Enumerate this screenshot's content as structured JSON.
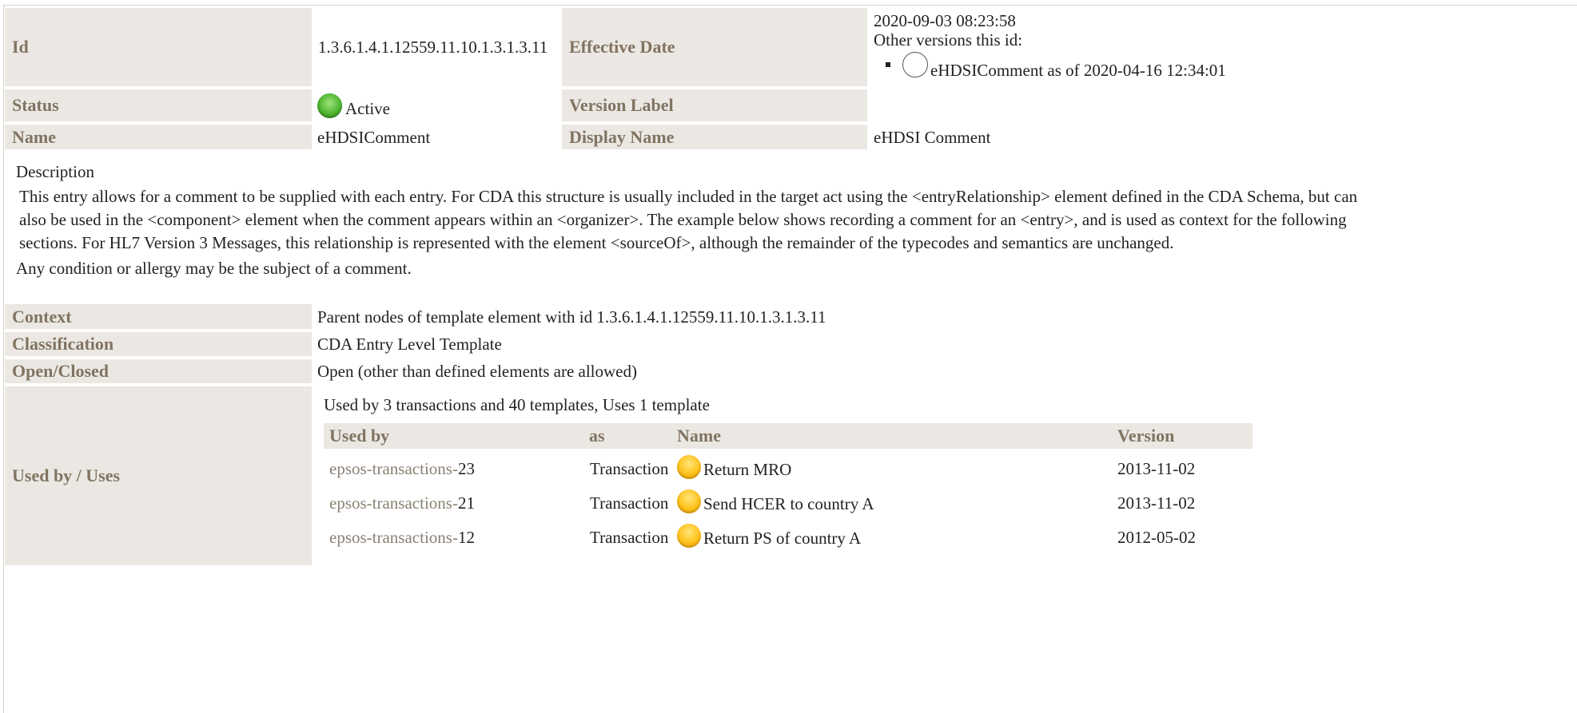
{
  "header": {
    "id_label": "Id",
    "id_value": "1.3.6.1.4.1.12559.11.10.1.3.1.3.11",
    "effective_date_label": "Effective Date",
    "effective_date_value": "2020-09-03 08:23:58",
    "other_versions_label": "Other versions this id:",
    "other_version_item": "eHDSIComment as of 2020-04-16 12:34:01",
    "status_label": "Status",
    "status_value": "Active",
    "status_color": "#4fb630",
    "version_label_label": "Version Label",
    "version_label_value": "",
    "name_label": "Name",
    "name_value": "eHDSIComment",
    "display_name_label": "Display Name",
    "display_name_value": "eHDSI Comment"
  },
  "description": {
    "heading": "Description",
    "line1": "This entry allows for a comment to be supplied with each entry. For CDA this structure is usually included in the target act using the <entryRelationship> element defined in the CDA Schema, but can",
    "line2": "also be used in the <component> element when the comment appears within an <organizer>. The example below shows recording a comment for an <entry>, and is used as context for the following",
    "line3": "sections. For HL7 Version 3 Messages, this relationship is represented with the element <sourceOf>, although the remainder of the typecodes and semantics are unchanged.",
    "paragraph2": "Any condition or allergy may be the subject of a comment."
  },
  "properties": {
    "context_label": "Context",
    "context_value": "Parent nodes of template element with id 1.3.6.1.4.1.12559.11.10.1.3.1.3.11",
    "classification_label": "Classification",
    "classification_value": "CDA Entry Level Template",
    "open_closed_label": "Open/Closed",
    "open_closed_value": "Open (other than defined elements are allowed)",
    "used_by_label": "Used by / Uses"
  },
  "usage": {
    "summary": "Used by 3 transactions and 40 templates, Uses 1 template",
    "columns": [
      "Used by",
      "as",
      "Name",
      "Version"
    ],
    "rows": [
      {
        "prefix": "epsos-transactions-",
        "num": "23",
        "as": "Transaction",
        "name": "Return MRO",
        "version": "2013-11-02"
      },
      {
        "prefix": "epsos-transactions-",
        "num": "21",
        "as": "Transaction",
        "name": "Send HCER to country A",
        "version": "2013-11-02"
      },
      {
        "prefix": "epsos-transactions-",
        "num": "12",
        "as": "Transaction",
        "name": "Return PS of country A",
        "version": "2012-05-02"
      }
    ],
    "status_color": "#ffc21a"
  }
}
